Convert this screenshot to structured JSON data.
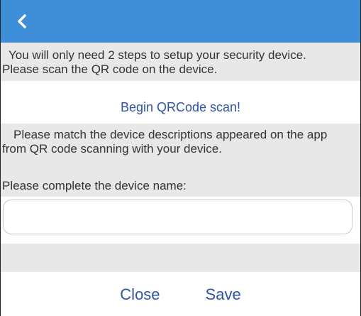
{
  "header": {
    "back_icon": "chevron-left-icon",
    "color": "#3f8ed8"
  },
  "step1": {
    "line1": "You will only need 2 steps to setup your security device.",
    "line2": "Please scan the QR code on the device."
  },
  "scan": {
    "label": "Begin QRCode scan!",
    "color": "#2f53a8"
  },
  "step2": {
    "line1": "Please match the device descriptions appeared on the app",
    "line2": "from QR code scanning with your device."
  },
  "device_name": {
    "label": "Please complete the device name:",
    "value": "",
    "placeholder": ""
  },
  "actions": {
    "close_label": "Close",
    "save_label": "Save"
  }
}
